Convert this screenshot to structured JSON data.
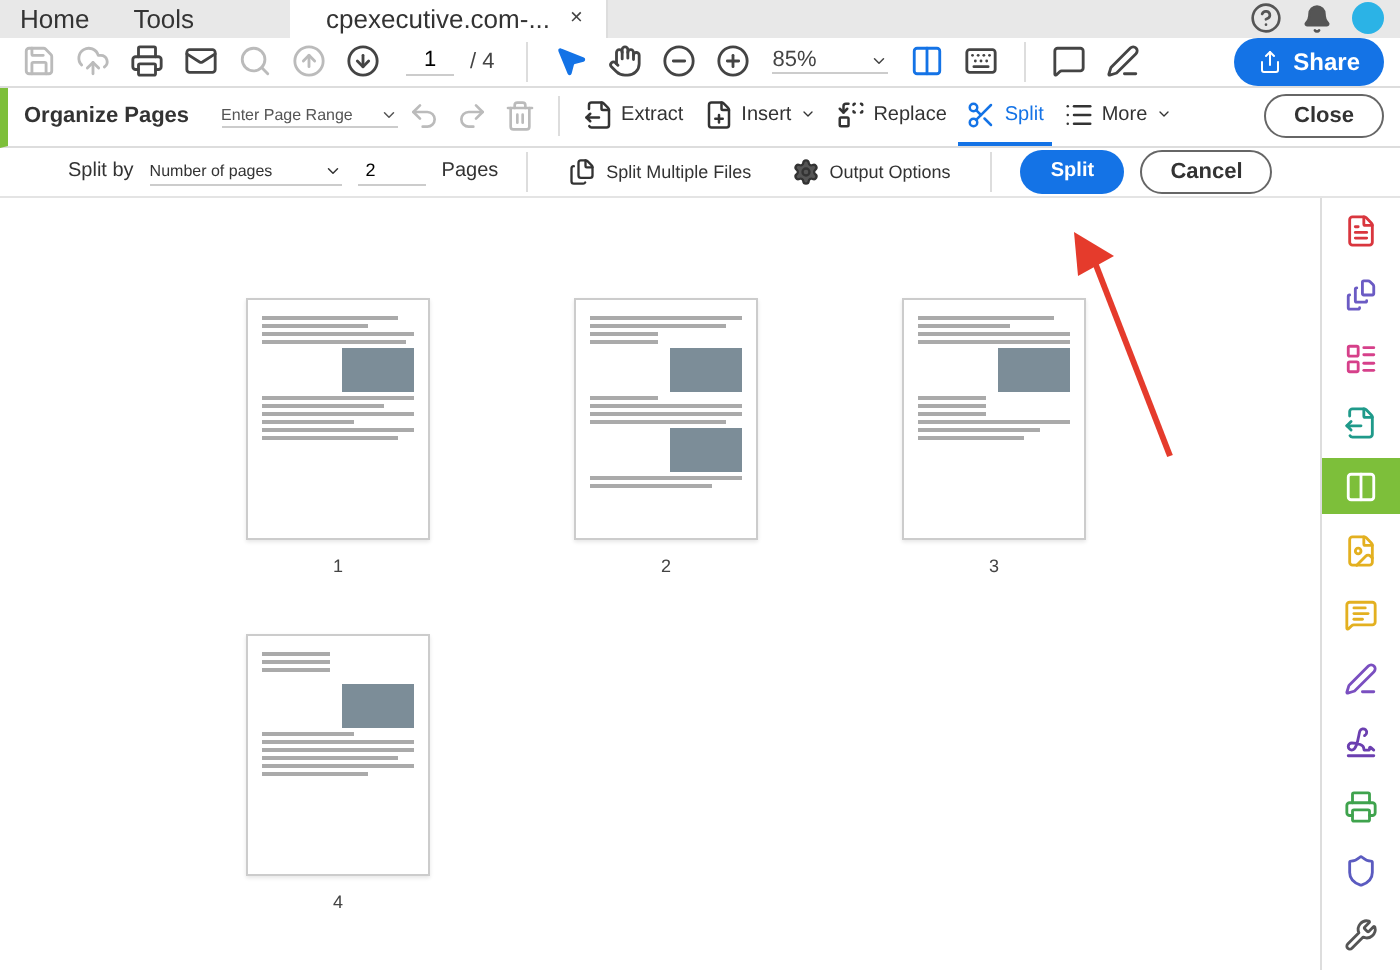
{
  "tabs": [
    {
      "label": "Home",
      "selected": false
    },
    {
      "label": "Tools",
      "selected": false
    },
    {
      "label": "cpexecutive.com-...",
      "selected": true,
      "close": "×"
    }
  ],
  "toolbar": {
    "file_tools": [
      {
        "disabled": true
      },
      {
        "disabled": true
      },
      {
        "disabled": false
      },
      {
        "disabled": false
      },
      {
        "disabled": true
      },
      {
        "disabled": true
      },
      {
        "disabled": false
      }
    ],
    "page_field": {
      "value": "1",
      "total": "/ 4"
    },
    "view_tools": [
      {
        "selected": true
      },
      {
        "selected": false
      },
      {
        "selected": false
      },
      {
        "selected": false
      }
    ],
    "zoom": {
      "value": "85%"
    },
    "share": "Share"
  },
  "organize_bar": {
    "title": "Organize Pages",
    "range": {
      "placeholder": "Enter Page Range"
    },
    "edit_tools": [
      {
        "disabled": true
      },
      {
        "disabled": true
      },
      {
        "disabled": true
      }
    ],
    "actions": [
      {
        "label": "Extract",
        "selected": false,
        "menu": false
      },
      {
        "label": "Insert",
        "selected": false,
        "menu": true
      },
      {
        "label": "Replace",
        "selected": false,
        "menu": false
      },
      {
        "label": "Split",
        "selected": true,
        "menu": false
      },
      {
        "label": "More",
        "selected": false,
        "menu": true
      }
    ],
    "close": "Close"
  },
  "split_bar": {
    "label": "Split by",
    "mode": "Number of pages",
    "count": "2",
    "unit": "Pages",
    "multiple": "Split Multiple Files",
    "options": "Output Options",
    "primary": "Split",
    "cancel": "Cancel"
  },
  "pages": [
    {
      "label": "1"
    },
    {
      "label": "2"
    },
    {
      "label": "3"
    },
    {
      "label": "4"
    }
  ],
  "sidebar": [
    {
      "color": "#d9363e",
      "selected": false
    },
    {
      "color": "#6b5bc4",
      "selected": false
    },
    {
      "color": "#d6408a",
      "selected": false
    },
    {
      "color": "#1f9a8a",
      "selected": false
    },
    {
      "color": "#7dbf3a",
      "selected": true
    },
    {
      "color": "#e3b020",
      "selected": false
    },
    {
      "color": "#e3b020",
      "selected": false
    },
    {
      "color": "#7a4fc0",
      "selected": false
    },
    {
      "color": "#6b3fb0",
      "selected": false
    },
    {
      "color": "#3fa34d",
      "selected": false
    },
    {
      "color": "#5b5bc0",
      "selected": false
    },
    {
      "color": "#555555",
      "selected": false
    }
  ]
}
